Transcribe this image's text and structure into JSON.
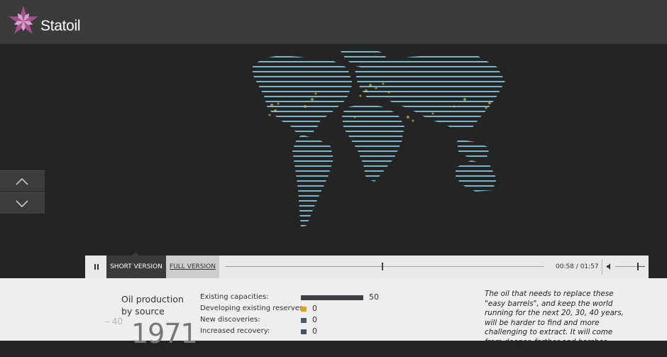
{
  "header": {
    "brand_name": "Statoil",
    "logo_icon": "star-flower-logo",
    "brand_color": "#a64f8e",
    "background": "#3b3b3b"
  },
  "side_nav": {
    "up_icon": "chevron-up-icon",
    "down_icon": "chevron-down-icon"
  },
  "player": {
    "pause_icon": "pause-icon",
    "tab_short": "SHORT VERSION",
    "tab_full": "FULL VERSION",
    "time": "00:58 / 01:57",
    "progress": 0.494,
    "played_color": "#45b8e0",
    "volume_icon": "speaker-icon",
    "volume": 0.75
  },
  "info": {
    "section_title": "Oil production by source",
    "scale_tick": "40",
    "year": "1971",
    "sources": [
      {
        "label": "Existing capacities:",
        "value": "50",
        "share": 1.0,
        "color": "#3c3e44"
      },
      {
        "label": "Developing existing reserves:",
        "value": "0",
        "share": 0,
        "color": "#dba126"
      },
      {
        "label": "New discoveries:",
        "value": "0",
        "share": 0,
        "color": "#4a586e"
      },
      {
        "label": "Increased recovery:",
        "value": "0",
        "share": 0,
        "color": "#4a5060"
      }
    ],
    "quote": "The oil that needs to replace these \"easy barrels\", and keep the world running for the next 20, 30, 40 years, will be harder to find and more challenging to extract. It will come from deeper, farther and harsher places."
  }
}
